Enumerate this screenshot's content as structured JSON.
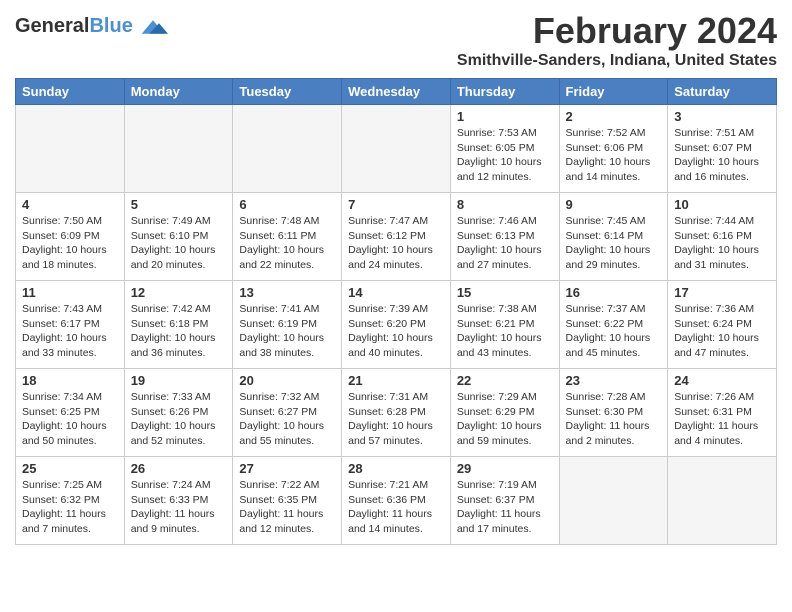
{
  "header": {
    "logo_general": "General",
    "logo_blue": "Blue",
    "month": "February 2024",
    "location": "Smithville-Sanders, Indiana, United States"
  },
  "days_of_week": [
    "Sunday",
    "Monday",
    "Tuesday",
    "Wednesday",
    "Thursday",
    "Friday",
    "Saturday"
  ],
  "weeks": [
    [
      {
        "day": "",
        "info": ""
      },
      {
        "day": "",
        "info": ""
      },
      {
        "day": "",
        "info": ""
      },
      {
        "day": "",
        "info": ""
      },
      {
        "day": "1",
        "info": "Sunrise: 7:53 AM\nSunset: 6:05 PM\nDaylight: 10 hours\nand 12 minutes."
      },
      {
        "day": "2",
        "info": "Sunrise: 7:52 AM\nSunset: 6:06 PM\nDaylight: 10 hours\nand 14 minutes."
      },
      {
        "day": "3",
        "info": "Sunrise: 7:51 AM\nSunset: 6:07 PM\nDaylight: 10 hours\nand 16 minutes."
      }
    ],
    [
      {
        "day": "4",
        "info": "Sunrise: 7:50 AM\nSunset: 6:09 PM\nDaylight: 10 hours\nand 18 minutes."
      },
      {
        "day": "5",
        "info": "Sunrise: 7:49 AM\nSunset: 6:10 PM\nDaylight: 10 hours\nand 20 minutes."
      },
      {
        "day": "6",
        "info": "Sunrise: 7:48 AM\nSunset: 6:11 PM\nDaylight: 10 hours\nand 22 minutes."
      },
      {
        "day": "7",
        "info": "Sunrise: 7:47 AM\nSunset: 6:12 PM\nDaylight: 10 hours\nand 24 minutes."
      },
      {
        "day": "8",
        "info": "Sunrise: 7:46 AM\nSunset: 6:13 PM\nDaylight: 10 hours\nand 27 minutes."
      },
      {
        "day": "9",
        "info": "Sunrise: 7:45 AM\nSunset: 6:14 PM\nDaylight: 10 hours\nand 29 minutes."
      },
      {
        "day": "10",
        "info": "Sunrise: 7:44 AM\nSunset: 6:16 PM\nDaylight: 10 hours\nand 31 minutes."
      }
    ],
    [
      {
        "day": "11",
        "info": "Sunrise: 7:43 AM\nSunset: 6:17 PM\nDaylight: 10 hours\nand 33 minutes."
      },
      {
        "day": "12",
        "info": "Sunrise: 7:42 AM\nSunset: 6:18 PM\nDaylight: 10 hours\nand 36 minutes."
      },
      {
        "day": "13",
        "info": "Sunrise: 7:41 AM\nSunset: 6:19 PM\nDaylight: 10 hours\nand 38 minutes."
      },
      {
        "day": "14",
        "info": "Sunrise: 7:39 AM\nSunset: 6:20 PM\nDaylight: 10 hours\nand 40 minutes."
      },
      {
        "day": "15",
        "info": "Sunrise: 7:38 AM\nSunset: 6:21 PM\nDaylight: 10 hours\nand 43 minutes."
      },
      {
        "day": "16",
        "info": "Sunrise: 7:37 AM\nSunset: 6:22 PM\nDaylight: 10 hours\nand 45 minutes."
      },
      {
        "day": "17",
        "info": "Sunrise: 7:36 AM\nSunset: 6:24 PM\nDaylight: 10 hours\nand 47 minutes."
      }
    ],
    [
      {
        "day": "18",
        "info": "Sunrise: 7:34 AM\nSunset: 6:25 PM\nDaylight: 10 hours\nand 50 minutes."
      },
      {
        "day": "19",
        "info": "Sunrise: 7:33 AM\nSunset: 6:26 PM\nDaylight: 10 hours\nand 52 minutes."
      },
      {
        "day": "20",
        "info": "Sunrise: 7:32 AM\nSunset: 6:27 PM\nDaylight: 10 hours\nand 55 minutes."
      },
      {
        "day": "21",
        "info": "Sunrise: 7:31 AM\nSunset: 6:28 PM\nDaylight: 10 hours\nand 57 minutes."
      },
      {
        "day": "22",
        "info": "Sunrise: 7:29 AM\nSunset: 6:29 PM\nDaylight: 10 hours\nand 59 minutes."
      },
      {
        "day": "23",
        "info": "Sunrise: 7:28 AM\nSunset: 6:30 PM\nDaylight: 11 hours\nand 2 minutes."
      },
      {
        "day": "24",
        "info": "Sunrise: 7:26 AM\nSunset: 6:31 PM\nDaylight: 11 hours\nand 4 minutes."
      }
    ],
    [
      {
        "day": "25",
        "info": "Sunrise: 7:25 AM\nSunset: 6:32 PM\nDaylight: 11 hours\nand 7 minutes."
      },
      {
        "day": "26",
        "info": "Sunrise: 7:24 AM\nSunset: 6:33 PM\nDaylight: 11 hours\nand 9 minutes."
      },
      {
        "day": "27",
        "info": "Sunrise: 7:22 AM\nSunset: 6:35 PM\nDaylight: 11 hours\nand 12 minutes."
      },
      {
        "day": "28",
        "info": "Sunrise: 7:21 AM\nSunset: 6:36 PM\nDaylight: 11 hours\nand 14 minutes."
      },
      {
        "day": "29",
        "info": "Sunrise: 7:19 AM\nSunset: 6:37 PM\nDaylight: 11 hours\nand 17 minutes."
      },
      {
        "day": "",
        "info": ""
      },
      {
        "day": "",
        "info": ""
      }
    ]
  ]
}
